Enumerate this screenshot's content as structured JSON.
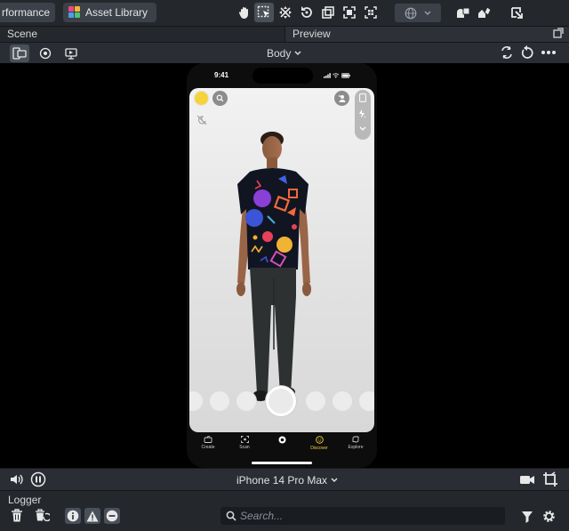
{
  "toolbar": {
    "performance_label": "rformance",
    "asset_library_label": "Asset Library",
    "tools": [
      "hand-tool",
      "select-tool",
      "move-tool",
      "rotate-tool",
      "scale-tool",
      "rect-tool",
      "grid-tool"
    ],
    "world_space": "globe",
    "right_icons": [
      "objects-icon",
      "components-icon",
      "publish-icon"
    ]
  },
  "panels": {
    "scene_tab": "Scene",
    "preview_tab": "Preview"
  },
  "preview": {
    "body_selector": "Body",
    "device_label": "iPhone 14 Pro Max",
    "phone_time": "9:41"
  },
  "phone_nav": {
    "items": [
      "Create",
      "Scan",
      "",
      "Discover",
      "Explore"
    ]
  },
  "logger": {
    "title": "Logger",
    "search_placeholder": "Search..."
  },
  "colors": {
    "accent_yellow": "#f5d33a",
    "toolbar_bg": "#24282d",
    "active_tool_bg": "#4a5059"
  }
}
